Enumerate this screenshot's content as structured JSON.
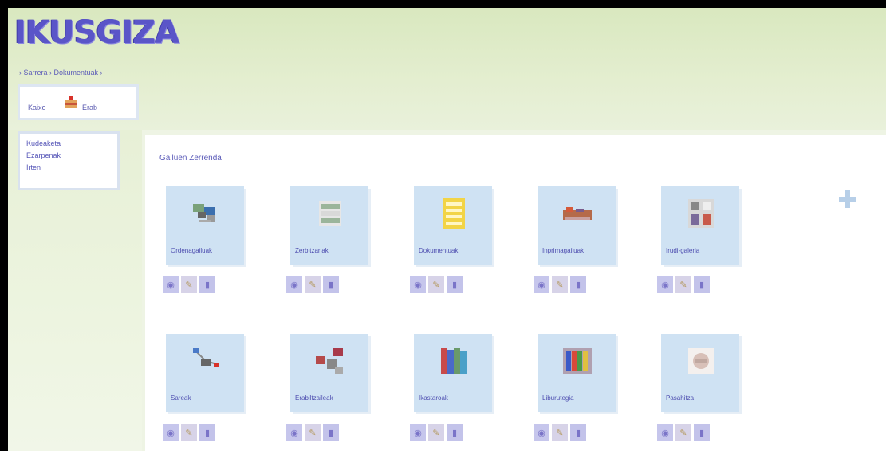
{
  "app": {
    "logo_text": "IKUSGIZA"
  },
  "header": {
    "breadcrumb": "› Sarrera  › Dokumentuak ›"
  },
  "user": {
    "greeting": "Kaixo",
    "name": "Erab"
  },
  "sidebar": {
    "items": [
      {
        "label": "Kudeaketa"
      },
      {
        "label": "Ezarpenak"
      },
      {
        "label": "Irten"
      }
    ]
  },
  "main": {
    "section_title": "Gailuen Zerrenda"
  },
  "tiles": [
    {
      "label": "Ordenagailuak",
      "icon": "network-computers-icon"
    },
    {
      "label": "Zerbitzariak",
      "icon": "server-rack-icon"
    },
    {
      "label": "Dokumentuak",
      "icon": "document-icon"
    },
    {
      "label": "Inprimagailuak",
      "icon": "printer-icon"
    },
    {
      "label": "Irudi-galeria",
      "icon": "photo-gallery-icon"
    },
    {
      "label": "Sareak",
      "icon": "network-diagram-icon"
    },
    {
      "label": "Erabiltzaileak",
      "icon": "user-group-icon"
    },
    {
      "label": "Ikastaroak",
      "icon": "library-books-icon"
    },
    {
      "label": "Liburutegia",
      "icon": "bookshelf-icon"
    },
    {
      "label": "Pasahitza",
      "icon": "lock-icon"
    }
  ],
  "tile_actions": {
    "view": "view-icon",
    "edit": "edit-icon",
    "delete": "delete-icon"
  },
  "colors": {
    "accent": "#5a55c8",
    "tile_bg": "#cfe2f3",
    "header_bg": "#e4eed0"
  }
}
